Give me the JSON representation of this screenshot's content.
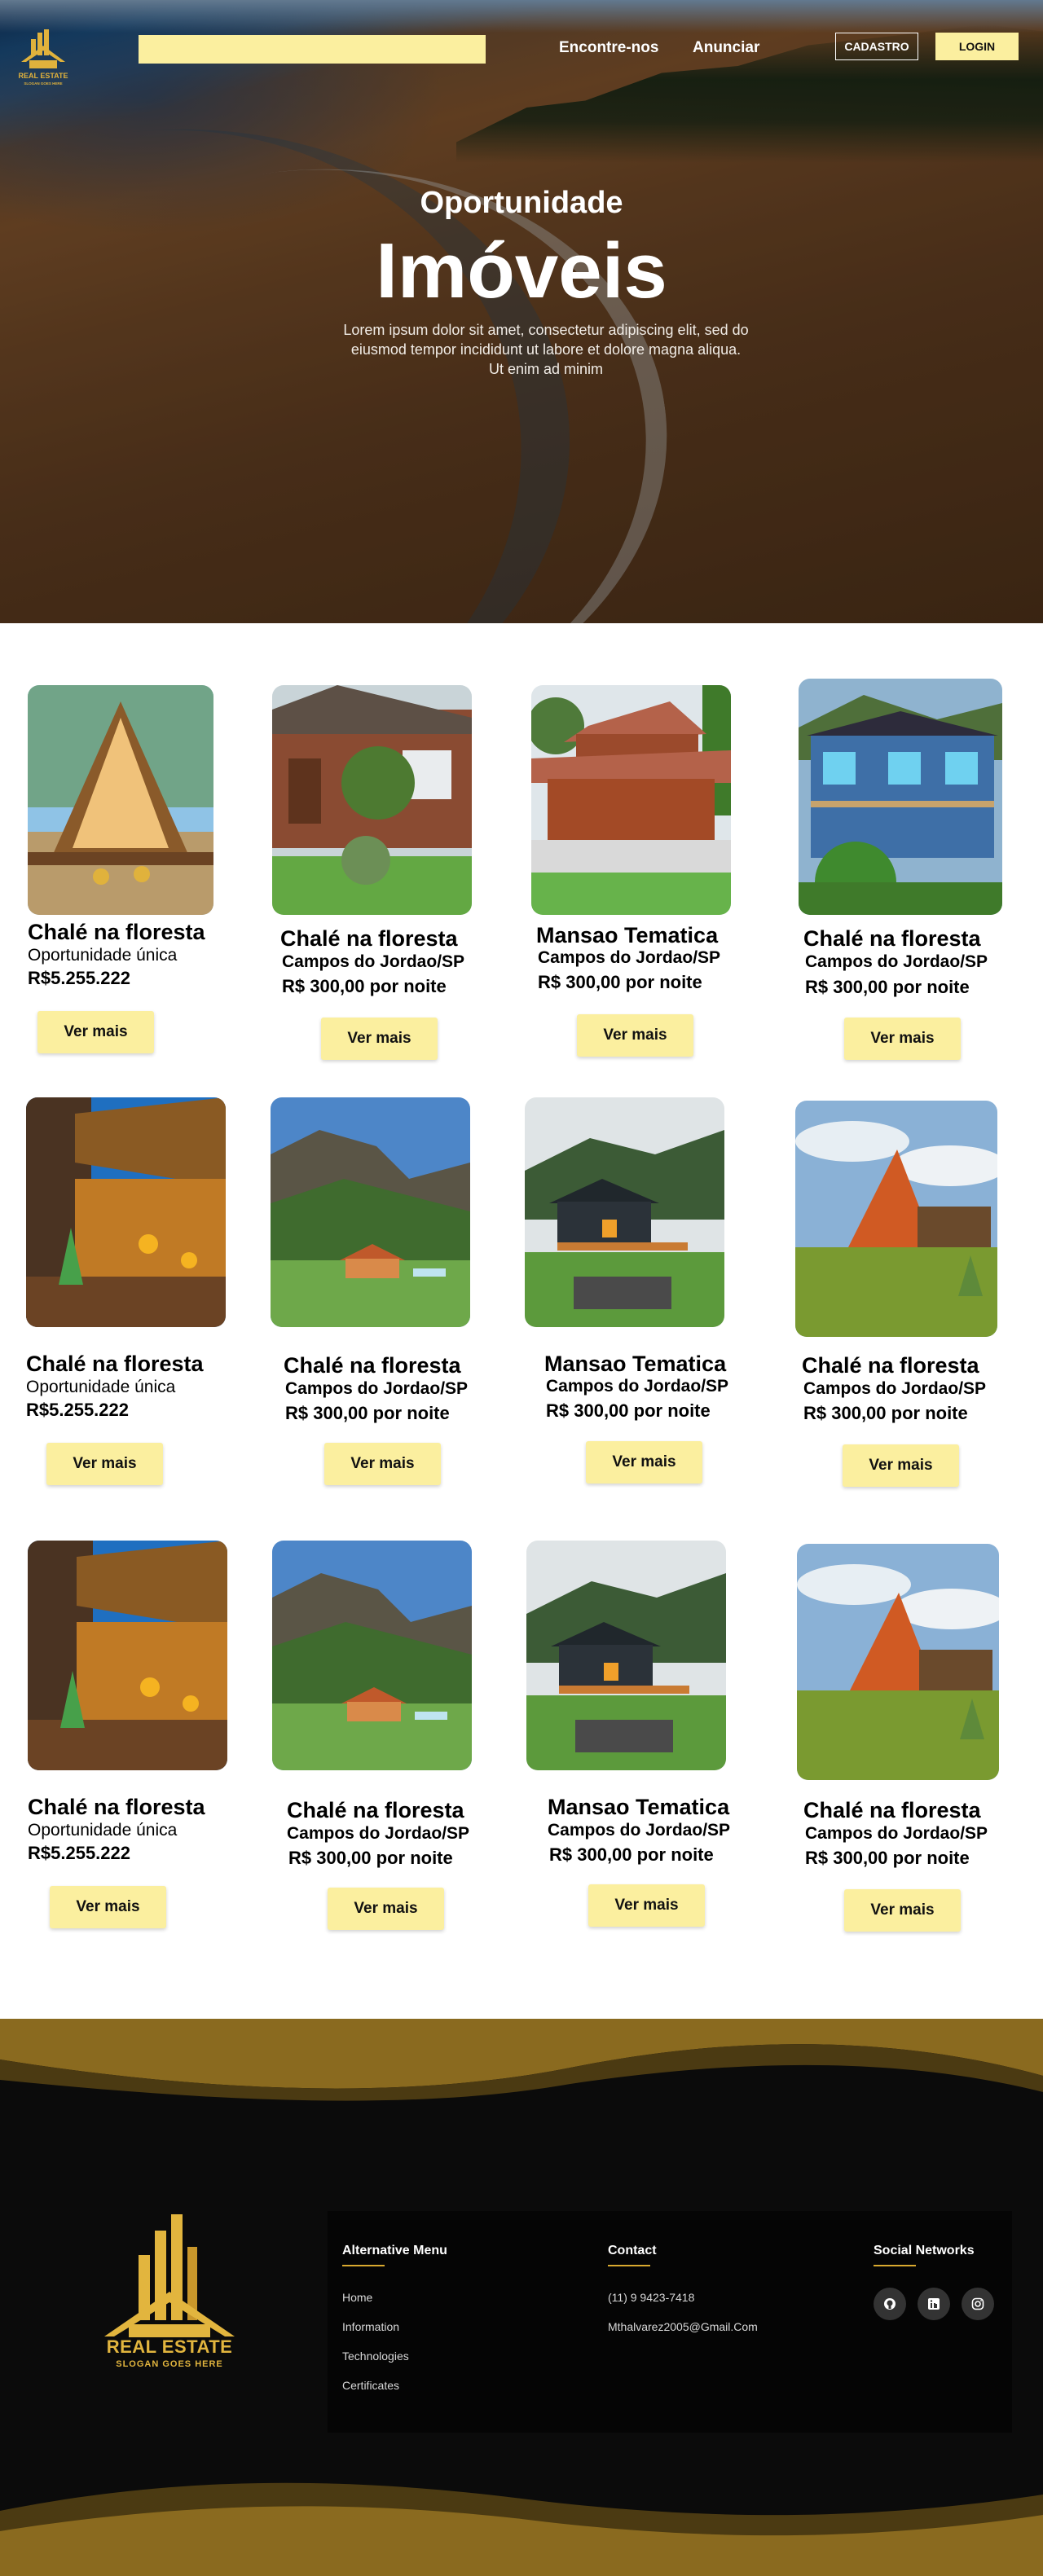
{
  "header": {
    "logo": {
      "name": "REAL ESTATE",
      "slogan": "SLOGAN GOES HERE"
    },
    "search": {
      "value": "",
      "placeholder": ""
    },
    "nav": [
      "Encontre-nos",
      "Anunciar"
    ],
    "cadastro_label": "CADASTRO",
    "login_label": "LOGIN"
  },
  "hero": {
    "subtitle": "Oportunidade",
    "title": "Imóveis",
    "text": "Lorem ipsum dolor sit amet, consectetur adipiscing elit, sed do eiusmod tempor incididunt ut labore et dolore magna aliqua. Ut enim ad minim"
  },
  "listings": [
    {
      "title": "Chalé na floresta",
      "line1": "Oportunidade única",
      "line2": "R$5.255.222",
      "button": "Ver mais",
      "image": "a-frame-chalet-photo"
    },
    {
      "title": "Chalé na floresta",
      "line1": "Campos do Jordao/SP",
      "line2": "R$ 300,00 por noite",
      "button": "Ver mais",
      "image": "wooden-house-garden-photo"
    },
    {
      "title": "Mansao Tematica",
      "line1": "Campos do Jordao/SP",
      "line2": "R$ 300,00 por noite",
      "button": "Ver mais",
      "image": "red-wood-mansion-photo"
    },
    {
      "title": "Chalé na floresta",
      "line1": "Campos do Jordao/SP",
      "line2": "R$ 300,00 por noite",
      "button": "Ver mais",
      "image": "blue-wooden-house-photo"
    },
    {
      "title": "Chalé na floresta",
      "line1": "Oportunidade única",
      "line2": "R$5.255.222",
      "button": "Ver mais",
      "image": "lit-wooden-deck-photo"
    },
    {
      "title": "Chalé na floresta",
      "line1": "Campos do Jordao/SP",
      "line2": "R$ 300,00 por noite",
      "button": "Ver mais",
      "image": "mountain-valley-house-photo"
    },
    {
      "title": "Mansao Tematica",
      "line1": "Campos do Jordao/SP",
      "line2": "R$ 300,00 por noite",
      "button": "Ver mais",
      "image": "dark-cabin-deck-photo"
    },
    {
      "title": "Chalé na floresta",
      "line1": "Campos do Jordao/SP",
      "line2": "R$ 300,00 por noite",
      "button": "Ver mais",
      "image": "orange-a-frame-photo"
    },
    {
      "title": "Chalé na floresta",
      "line1": "Oportunidade única",
      "line2": "R$5.255.222",
      "button": "Ver mais",
      "image": "lit-wooden-deck-photo"
    },
    {
      "title": "Chalé na floresta",
      "line1": "Campos do Jordao/SP",
      "line2": "R$ 300,00 por noite",
      "button": "Ver mais",
      "image": "mountain-valley-house-photo"
    },
    {
      "title": "Mansao Tematica",
      "line1": "Campos do Jordao/SP",
      "line2": "R$ 300,00 por noite",
      "button": "Ver mais",
      "image": "dark-cabin-deck-photo"
    },
    {
      "title": "Chalé na floresta",
      "line1": "Campos do Jordao/SP",
      "line2": "R$ 300,00 por noite",
      "button": "Ver mais",
      "image": "orange-a-frame-photo"
    }
  ],
  "footer": {
    "logo": {
      "name": "REAL ESTATE",
      "slogan": "SLOGAN GOES HERE"
    },
    "menu": {
      "heading": "Alternative Menu",
      "items": [
        "Home",
        "Information",
        "Technologies",
        "Certificates"
      ]
    },
    "contact": {
      "heading": "Contact",
      "phone": "(11) 9 9423-7418",
      "email": "Mthalvarez2005@Gmail.Com"
    },
    "social": {
      "heading": "Social Networks",
      "icons": [
        "github-icon",
        "linkedin-icon",
        "instagram-icon"
      ]
    }
  },
  "colors": {
    "accent": "#fbef9f",
    "gold": "#d9a92f",
    "footer_bg": "#0b0b0b",
    "wave": "#8a6a1f"
  }
}
